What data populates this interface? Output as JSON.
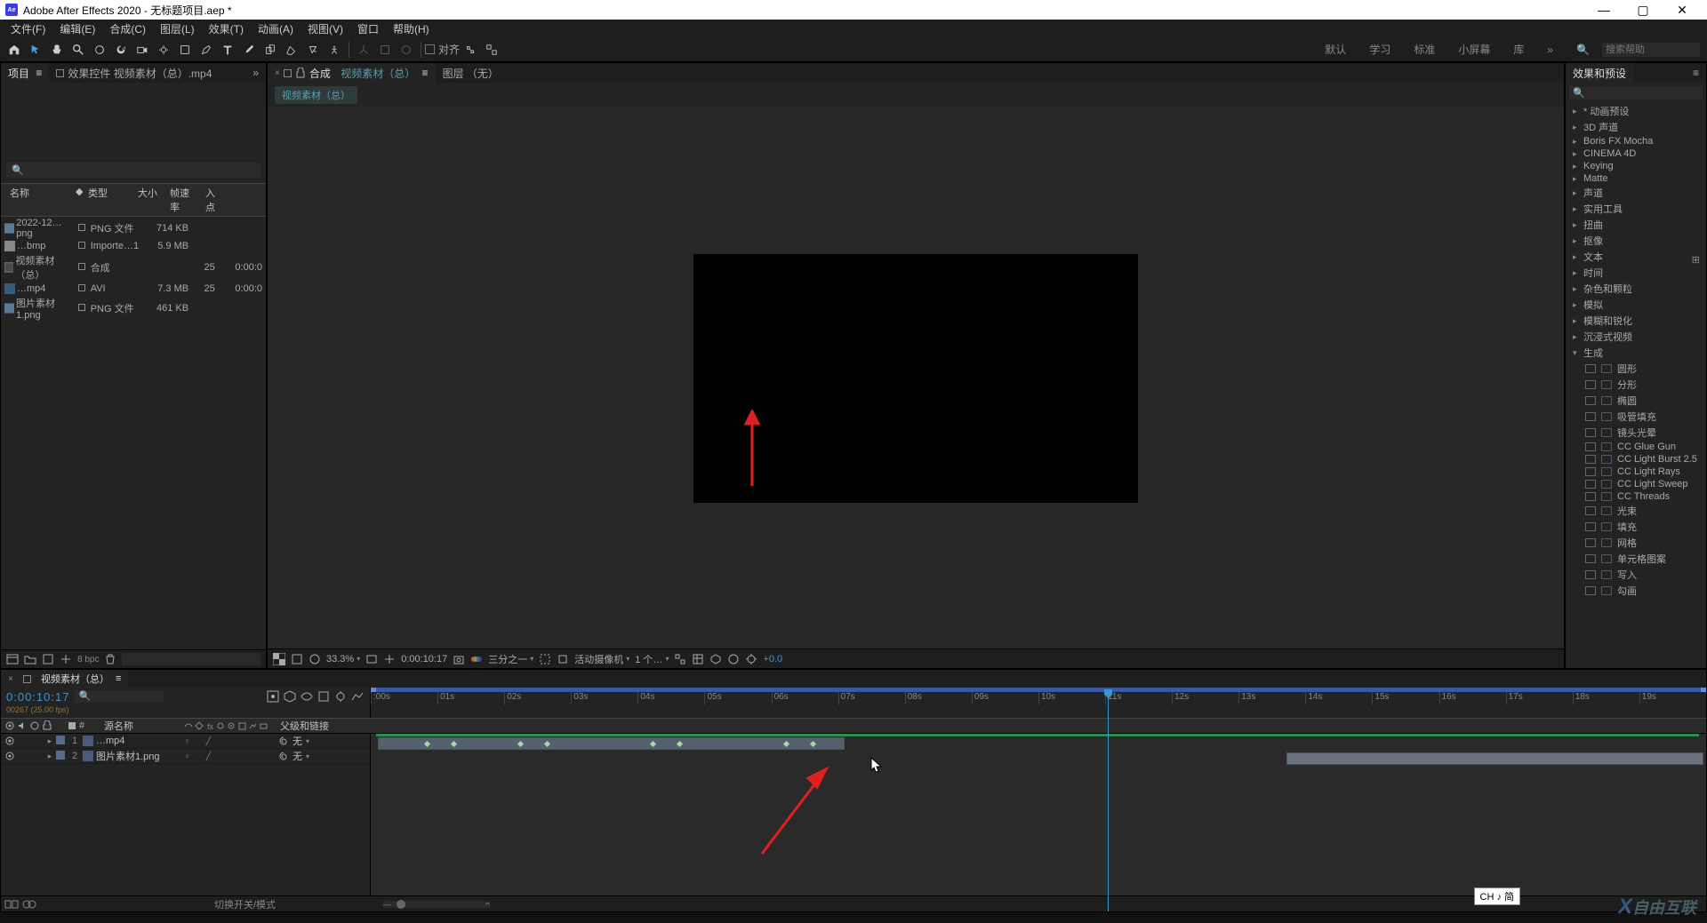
{
  "title": "Adobe After Effects 2020 - 无标题项目.aep *",
  "menus": [
    "文件(F)",
    "编辑(E)",
    "合成(C)",
    "图层(L)",
    "效果(T)",
    "动画(A)",
    "视图(V)",
    "窗口",
    "帮助(H)"
  ],
  "toolbar": {
    "align": "对齐"
  },
  "workspaces": [
    "默认",
    "学习",
    "标准",
    "小屏幕",
    "库"
  ],
  "search_placeholder": "搜索帮助",
  "project": {
    "tab": "项目",
    "effects_tab": "效果控件 视频素材（总）.mp4",
    "search": "",
    "cols": {
      "name": "名称",
      "type": "类型",
      "size": "大小",
      "fps": "帧速率",
      "inp": "入点"
    },
    "rows": [
      {
        "name": "2022-12…png",
        "type": "PNG 文件",
        "size": "714 KB",
        "fps": "",
        "dur": ""
      },
      {
        "name": "…bmp",
        "type": "Importe…1",
        "size": "5.9 MB",
        "fps": "",
        "dur": ""
      },
      {
        "name": "视频素材（总）",
        "type": "合成",
        "size": "",
        "fps": "25",
        "dur": "0:00:0"
      },
      {
        "name": "…mp4",
        "type": "AVI",
        "size": "7.3 MB",
        "fps": "25",
        "dur": "0:00:0"
      },
      {
        "name": "图片素材1.png",
        "type": "PNG 文件",
        "size": "461 KB",
        "fps": "",
        "dur": ""
      }
    ],
    "bpc": "8 bpc"
  },
  "comp": {
    "label": "合成",
    "name": "视频素材（总）",
    "layer_tab": "图层 （无）",
    "crumb": "视频素材（总）",
    "footer": {
      "zoom": "33.3%",
      "time": "0:00:10:17",
      "res": "三分之一",
      "camera": "活动摄像机",
      "view": "1 个…",
      "exposure": "+0.0"
    }
  },
  "fx": {
    "tab": "效果和预设",
    "groups": [
      "* 动画预设",
      "3D 声道",
      "Boris FX Mocha",
      "CINEMA 4D",
      "Keying",
      "Matte",
      "声道",
      "实用工具",
      "扭曲",
      "抠像",
      "文本",
      "时间",
      "杂色和颗粒",
      "模拟",
      "模糊和锐化",
      "沉浸式视频"
    ],
    "open": "生成",
    "leaves": [
      "圆形",
      "分形",
      "椭圆",
      "吸管填充",
      "镜头光晕",
      "CC Glue Gun",
      "CC Light Burst 2.5",
      "CC Light Rays",
      "CC Light Sweep",
      "CC Threads",
      "光束",
      "填充",
      "网格",
      "单元格图案",
      "写入",
      "勾画"
    ]
  },
  "timeline": {
    "tab": "视频素材（总）",
    "timecode": "0:00:10:17",
    "frames": "00267 (25.00 fps)",
    "cols": {
      "src": "源名称",
      "parent": "父级和链接"
    },
    "none": "无",
    "switches_label": "切换开关/模式",
    "ticks": [
      ":00s",
      "01s",
      "02s",
      "03s",
      "04s",
      "05s",
      "06s",
      "07s",
      "08s",
      "09s",
      "10s",
      "11s",
      "12s",
      "13s",
      "14s",
      "15s",
      "16s",
      "17s",
      "18s",
      "19s"
    ],
    "layers": [
      {
        "num": "1",
        "name": "…mp4",
        "parent": "无",
        "bar_start": 0.005,
        "bar_end": 0.355,
        "kfs": [
          0.04,
          0.06,
          0.11,
          0.13,
          0.21,
          0.23,
          0.31,
          0.33
        ]
      },
      {
        "num": "2",
        "name": "图片素材1.png",
        "parent": "无",
        "bar_start": 0.686,
        "bar_end": 0.998,
        "kfs": []
      }
    ],
    "playhead": 0.552
  },
  "ime": "CH ♪ 简",
  "watermark": "自由互联"
}
